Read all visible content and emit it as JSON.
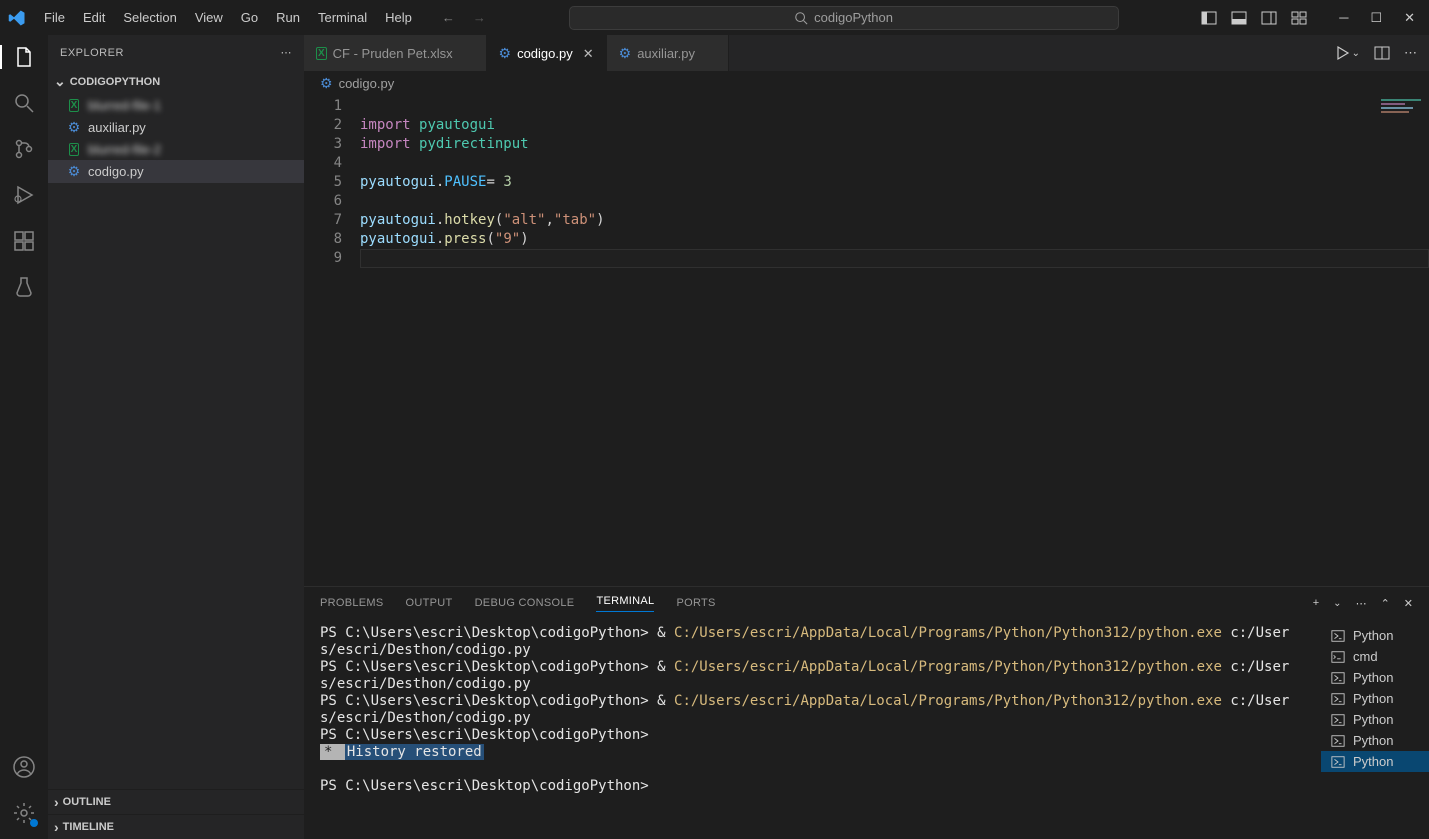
{
  "titlebar": {
    "menus": [
      "File",
      "Edit",
      "Selection",
      "View",
      "Go",
      "Run",
      "Terminal",
      "Help"
    ],
    "search_text": "codigoPython"
  },
  "sidebar": {
    "title": "EXPLORER",
    "folder": "CODIGOPYTHON",
    "files": [
      {
        "label": "blurred-file-1",
        "type": "excel",
        "blur": true
      },
      {
        "label": "auxiliar.py",
        "type": "py",
        "blur": false
      },
      {
        "label": "blurred-file-2",
        "type": "excel",
        "blur": true
      },
      {
        "label": "codigo.py",
        "type": "py",
        "blur": false,
        "selected": true
      }
    ],
    "sections": [
      "OUTLINE",
      "TIMELINE"
    ]
  },
  "tabs": [
    {
      "label": "CF - Pruden Pet.xlsx",
      "type": "excel",
      "active": false
    },
    {
      "label": "codigo.py",
      "type": "py",
      "active": true
    },
    {
      "label": "auxiliar.py",
      "type": "py",
      "active": false
    }
  ],
  "breadcrumb": {
    "icon": "py",
    "label": "codigo.py"
  },
  "code": {
    "lines": [
      "1",
      "2",
      "3",
      "4",
      "5",
      "6",
      "7",
      "8",
      "9"
    ],
    "tokens": [
      [],
      [
        {
          "c": "kw",
          "t": "import"
        },
        {
          "c": "pun",
          "t": " "
        },
        {
          "c": "mod",
          "t": "pyautogui"
        }
      ],
      [
        {
          "c": "kw",
          "t": "import"
        },
        {
          "c": "pun",
          "t": " "
        },
        {
          "c": "mod",
          "t": "pydirectinput"
        }
      ],
      [],
      [
        {
          "c": "var",
          "t": "pyautogui"
        },
        {
          "c": "pun",
          "t": "."
        },
        {
          "c": "const",
          "t": "PAUSE"
        },
        {
          "c": "pun",
          "t": "= "
        },
        {
          "c": "num",
          "t": "3"
        }
      ],
      [],
      [
        {
          "c": "var",
          "t": "pyautogui"
        },
        {
          "c": "pun",
          "t": "."
        },
        {
          "c": "fn",
          "t": "hotkey"
        },
        {
          "c": "pun",
          "t": "("
        },
        {
          "c": "str",
          "t": "\"alt\""
        },
        {
          "c": "pun",
          "t": ","
        },
        {
          "c": "str",
          "t": "\"tab\""
        },
        {
          "c": "pun",
          "t": ")"
        }
      ],
      [
        {
          "c": "var",
          "t": "pyautogui"
        },
        {
          "c": "pun",
          "t": "."
        },
        {
          "c": "fn",
          "t": "press"
        },
        {
          "c": "pun",
          "t": "("
        },
        {
          "c": "str",
          "t": "\"9\""
        },
        {
          "c": "pun",
          "t": ")"
        }
      ],
      []
    ]
  },
  "panel": {
    "tabs": [
      "PROBLEMS",
      "OUTPUT",
      "DEBUG CONSOLE",
      "TERMINAL",
      "PORTS"
    ],
    "active_tab": "TERMINAL",
    "terminal_list": [
      {
        "label": "Python",
        "icon": "ps"
      },
      {
        "label": "cmd",
        "icon": "cmd"
      },
      {
        "label": "Python",
        "icon": "ps"
      },
      {
        "label": "Python",
        "icon": "ps"
      },
      {
        "label": "Python",
        "icon": "ps"
      },
      {
        "label": "Python",
        "icon": "ps"
      },
      {
        "label": "Python",
        "icon": "ps",
        "active": true
      }
    ],
    "terminal_lines": [
      {
        "prompt": "PS C:\\Users\\escri\\Desktop\\codigoPython> ",
        "amp": "& ",
        "exe": "C:/Users/escri/AppData/Local/Programs/Python/Python312/python.exe",
        "arg": " c:/Users/escri/Desthon/codigo.py"
      },
      {
        "prompt": "PS C:\\Users\\escri\\Desktop\\codigoPython> ",
        "amp": "& ",
        "exe": "C:/Users/escri/AppData/Local/Programs/Python/Python312/python.exe",
        "arg": " c:/Users/escri/Desthon/codigo.py"
      },
      {
        "prompt": "PS C:\\Users\\escri\\Desktop\\codigoPython> ",
        "amp": "& ",
        "exe": "C:/Users/escri/AppData/Local/Programs/Python/Python312/python.exe",
        "arg": " c:/Users/escri/Desthon/codigo.py"
      },
      {
        "prompt": "PS C:\\Users\\escri\\Desktop\\codigoPython>"
      }
    ],
    "history_star": " * ",
    "history_label": " History restored ",
    "final_prompt": "PS C:\\Users\\escri\\Desktop\\codigoPython>"
  }
}
